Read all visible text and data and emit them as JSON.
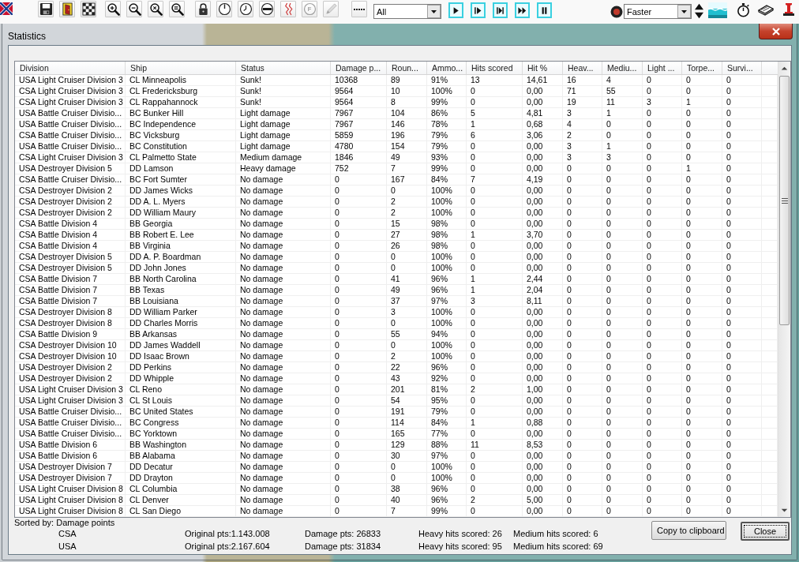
{
  "toolbar": {
    "tools": [
      {
        "disabled": false
      },
      {
        "disabled": false
      },
      {
        "disabled": false
      },
      {
        "disabled": false
      },
      {
        "disabled": false
      },
      {
        "disabled": false
      },
      {
        "disabled": false
      },
      {
        "disabled": false
      },
      {
        "disabled": false
      },
      {
        "disabled": false
      },
      {
        "disabled": false
      },
      {
        "disabled": false
      },
      {
        "disabled": true,
        "label": "F"
      },
      {
        "disabled": true
      },
      {
        "disabled": false
      }
    ],
    "ship_filter": {
      "value": "All"
    },
    "speed": {
      "value": "Faster"
    }
  },
  "window": {
    "title": "Statistics"
  },
  "table": {
    "columns": [
      "Division",
      "Ship",
      "Status",
      "Damage p...",
      "Roun...",
      "Ammo...",
      "Hits scored",
      "Hit %",
      "Heav...",
      "Mediu...",
      "Light ...",
      "Torpe...",
      "Survi..."
    ],
    "rows": [
      [
        "USA Light Cruiser Division 3",
        "CL Minneapolis",
        "Sunk!",
        "10368",
        "89",
        "91%",
        "13",
        "14,61",
        "16",
        "4",
        "0",
        "0",
        "0"
      ],
      [
        "CSA Light Cruiser Division 3",
        "CL Fredericksburg",
        "Sunk!",
        "9564",
        "10",
        "100%",
        "0",
        "0,00",
        "71",
        "55",
        "0",
        "0",
        "0"
      ],
      [
        "CSA Light Cruiser Division 3",
        "CL Rappahannock",
        "Sunk!",
        "9564",
        "8",
        "99%",
        "0",
        "0,00",
        "19",
        "11",
        "3",
        "1",
        "0"
      ],
      [
        "USA Battle Cruiser Divisio...",
        "BC Bunker Hill",
        "Light damage",
        "7967",
        "104",
        "86%",
        "5",
        "4,81",
        "3",
        "1",
        "0",
        "0",
        "0"
      ],
      [
        "USA Battle Cruiser Divisio...",
        "BC Independence",
        "Light damage",
        "7967",
        "146",
        "78%",
        "1",
        "0,68",
        "4",
        "0",
        "0",
        "0",
        "0"
      ],
      [
        "CSA Battle Cruiser Divisio...",
        "BC Vicksburg",
        "Light damage",
        "5859",
        "196",
        "79%",
        "6",
        "3,06",
        "2",
        "0",
        "0",
        "0",
        "0"
      ],
      [
        "USA Battle Cruiser Divisio...",
        "BC Constitution",
        "Light damage",
        "4780",
        "154",
        "79%",
        "0",
        "0,00",
        "3",
        "1",
        "0",
        "0",
        "0"
      ],
      [
        "CSA Light Cruiser Division 3",
        "CL Palmetto State",
        "Medium damage",
        "1846",
        "49",
        "93%",
        "0",
        "0,00",
        "3",
        "3",
        "0",
        "0",
        "0"
      ],
      [
        "USA Destroyer Division 5",
        "DD Lamson",
        "Heavy damage",
        "752",
        "7",
        "99%",
        "0",
        "0,00",
        "0",
        "0",
        "0",
        "1",
        "0"
      ],
      [
        "CSA Battle Cruiser Divisio...",
        "BC Fort Sumter",
        "No damage",
        "0",
        "167",
        "84%",
        "7",
        "4,19",
        "0",
        "0",
        "0",
        "0",
        "0"
      ],
      [
        "CSA Destroyer Division 2",
        "DD James Wicks",
        "No damage",
        "0",
        "0",
        "100%",
        "0",
        "0,00",
        "0",
        "0",
        "0",
        "0",
        "0"
      ],
      [
        "CSA Destroyer Division 2",
        "DD A. L. Myers",
        "No damage",
        "0",
        "2",
        "100%",
        "0",
        "0,00",
        "0",
        "0",
        "0",
        "0",
        "0"
      ],
      [
        "CSA Destroyer Division 2",
        "DD William Maury",
        "No damage",
        "0",
        "2",
        "100%",
        "0",
        "0,00",
        "0",
        "0",
        "0",
        "0",
        "0"
      ],
      [
        "CSA Battle Division 4",
        "BB Georgia",
        "No damage",
        "0",
        "15",
        "98%",
        "0",
        "0,00",
        "0",
        "0",
        "0",
        "0",
        "0"
      ],
      [
        "CSA Battle Division 4",
        "BB Robert E. Lee",
        "No damage",
        "0",
        "27",
        "98%",
        "1",
        "3,70",
        "0",
        "0",
        "0",
        "0",
        "0"
      ],
      [
        "CSA Battle Division 4",
        "BB Virginia",
        "No damage",
        "0",
        "26",
        "98%",
        "0",
        "0,00",
        "0",
        "0",
        "0",
        "0",
        "0"
      ],
      [
        "CSA Destroyer Division 5",
        "DD A. P. Boardman",
        "No damage",
        "0",
        "0",
        "100%",
        "0",
        "0,00",
        "0",
        "0",
        "0",
        "0",
        "0"
      ],
      [
        "CSA Destroyer Division 5",
        "DD John Jones",
        "No damage",
        "0",
        "0",
        "100%",
        "0",
        "0,00",
        "0",
        "0",
        "0",
        "0",
        "0"
      ],
      [
        "CSA Battle Division 7",
        "BB North Carolina",
        "No damage",
        "0",
        "41",
        "96%",
        "1",
        "2,44",
        "0",
        "0",
        "0",
        "0",
        "0"
      ],
      [
        "CSA Battle Division 7",
        "BB Texas",
        "No damage",
        "0",
        "49",
        "96%",
        "1",
        "2,04",
        "0",
        "0",
        "0",
        "0",
        "0"
      ],
      [
        "CSA Battle Division 7",
        "BB Louisiana",
        "No damage",
        "0",
        "37",
        "97%",
        "3",
        "8,11",
        "0",
        "0",
        "0",
        "0",
        "0"
      ],
      [
        "CSA Destroyer Division 8",
        "DD William Parker",
        "No damage",
        "0",
        "3",
        "100%",
        "0",
        "0,00",
        "0",
        "0",
        "0",
        "0",
        "0"
      ],
      [
        "CSA Destroyer Division 8",
        "DD Charles Morris",
        "No damage",
        "0",
        "0",
        "100%",
        "0",
        "0,00",
        "0",
        "0",
        "0",
        "0",
        "0"
      ],
      [
        "CSA Battle Division 9",
        "BB Arkansas",
        "No damage",
        "0",
        "55",
        "94%",
        "0",
        "0,00",
        "0",
        "0",
        "0",
        "0",
        "0"
      ],
      [
        "CSA Destroyer Division 10",
        "DD James Waddell",
        "No damage",
        "0",
        "0",
        "100%",
        "0",
        "0,00",
        "0",
        "0",
        "0",
        "0",
        "0"
      ],
      [
        "CSA Destroyer Division 10",
        "DD Isaac Brown",
        "No damage",
        "0",
        "2",
        "100%",
        "0",
        "0,00",
        "0",
        "0",
        "0",
        "0",
        "0"
      ],
      [
        "USA Destroyer Division 2",
        "DD Perkins",
        "No damage",
        "0",
        "22",
        "96%",
        "0",
        "0,00",
        "0",
        "0",
        "0",
        "0",
        "0"
      ],
      [
        "USA Destroyer Division 2",
        "DD Whipple",
        "No damage",
        "0",
        "43",
        "92%",
        "0",
        "0,00",
        "0",
        "0",
        "0",
        "0",
        "0"
      ],
      [
        "USA Light Cruiser Division 3",
        "CL Reno",
        "No damage",
        "0",
        "201",
        "81%",
        "2",
        "1,00",
        "0",
        "0",
        "0",
        "0",
        "0"
      ],
      [
        "USA Light Cruiser Division 3",
        "CL St Louis",
        "No damage",
        "0",
        "54",
        "95%",
        "0",
        "0,00",
        "0",
        "0",
        "0",
        "0",
        "0"
      ],
      [
        "USA Battle Cruiser Divisio...",
        "BC United States",
        "No damage",
        "0",
        "191",
        "79%",
        "0",
        "0,00",
        "0",
        "0",
        "0",
        "0",
        "0"
      ],
      [
        "USA Battle Cruiser Divisio...",
        "BC Congress",
        "No damage",
        "0",
        "114",
        "84%",
        "1",
        "0,88",
        "0",
        "0",
        "0",
        "0",
        "0"
      ],
      [
        "USA Battle Cruiser Divisio...",
        "BC Yorktown",
        "No damage",
        "0",
        "165",
        "77%",
        "0",
        "0,00",
        "0",
        "0",
        "0",
        "0",
        "0"
      ],
      [
        "USA Battle Division 6",
        "BB Washington",
        "No damage",
        "0",
        "129",
        "88%",
        "11",
        "8,53",
        "0",
        "0",
        "0",
        "0",
        "0"
      ],
      [
        "USA Battle Division 6",
        "BB Alabama",
        "No damage",
        "0",
        "30",
        "97%",
        "0",
        "0,00",
        "0",
        "0",
        "0",
        "0",
        "0"
      ],
      [
        "USA Destroyer Division 7",
        "DD Decatur",
        "No damage",
        "0",
        "0",
        "100%",
        "0",
        "0,00",
        "0",
        "0",
        "0",
        "0",
        "0"
      ],
      [
        "USA Destroyer Division 7",
        "DD Drayton",
        "No damage",
        "0",
        "0",
        "100%",
        "0",
        "0,00",
        "0",
        "0",
        "0",
        "0",
        "0"
      ],
      [
        "USA Light Cruiser Division 8",
        "CL Columbia",
        "No damage",
        "0",
        "38",
        "96%",
        "0",
        "0,00",
        "0",
        "0",
        "0",
        "0",
        "0"
      ],
      [
        "USA Light Cruiser Division 8",
        "CL Denver",
        "No damage",
        "0",
        "40",
        "96%",
        "2",
        "5,00",
        "0",
        "0",
        "0",
        "0",
        "0"
      ],
      [
        "USA Light Cruiser Division 8",
        "CL San Diego",
        "No damage",
        "0",
        "7",
        "99%",
        "0",
        "0,00",
        "0",
        "0",
        "0",
        "0",
        "0"
      ]
    ]
  },
  "footer": {
    "sorted_by": "Sorted by: Damage points",
    "summary": [
      {
        "side": "CSA",
        "original_pts": "Original pts:1.143.008",
        "damage_pts": "Damage pts: 26833",
        "heavy_hits": "Heavy hits scored: 26",
        "medium_hits": "Medium hits scored: 6"
      },
      {
        "side": "USA",
        "original_pts": "Original pts:2.167.604",
        "damage_pts": "Damage pts: 31834",
        "heavy_hits": "Heavy hits scored: 95",
        "medium_hits": "Medium hits scored: 69"
      }
    ]
  },
  "buttons": [
    {
      "label": "Copy to clipboard",
      "default": false
    },
    {
      "label": "Close",
      "default": true
    }
  ]
}
